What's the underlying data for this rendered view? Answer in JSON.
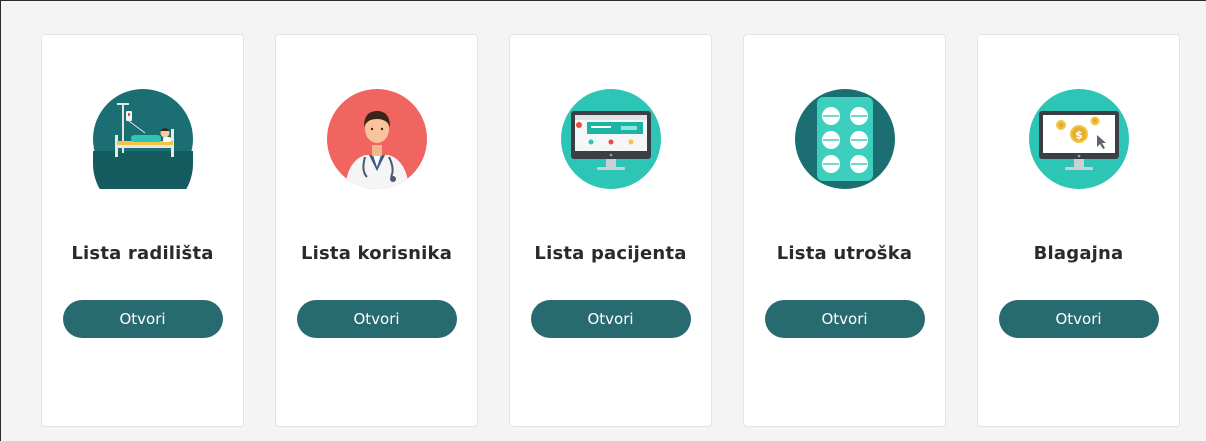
{
  "colors": {
    "button": "#276a70",
    "card": "#ffffff",
    "background": "#f4f4f4"
  },
  "cards": [
    {
      "title": "Lista radilišta",
      "button_label": "Otvori",
      "icon": "hospital-bed-icon"
    },
    {
      "title": "Lista korisnika",
      "button_label": "Otvori",
      "icon": "doctor-icon"
    },
    {
      "title": "Lista pacijenta",
      "button_label": "Otvori",
      "icon": "monitor-dashboard-icon"
    },
    {
      "title": "Lista utroška",
      "button_label": "Otvori",
      "icon": "pill-pack-icon"
    },
    {
      "title": "Blagajna",
      "button_label": "Otvori",
      "icon": "monitor-coins-icon"
    }
  ]
}
